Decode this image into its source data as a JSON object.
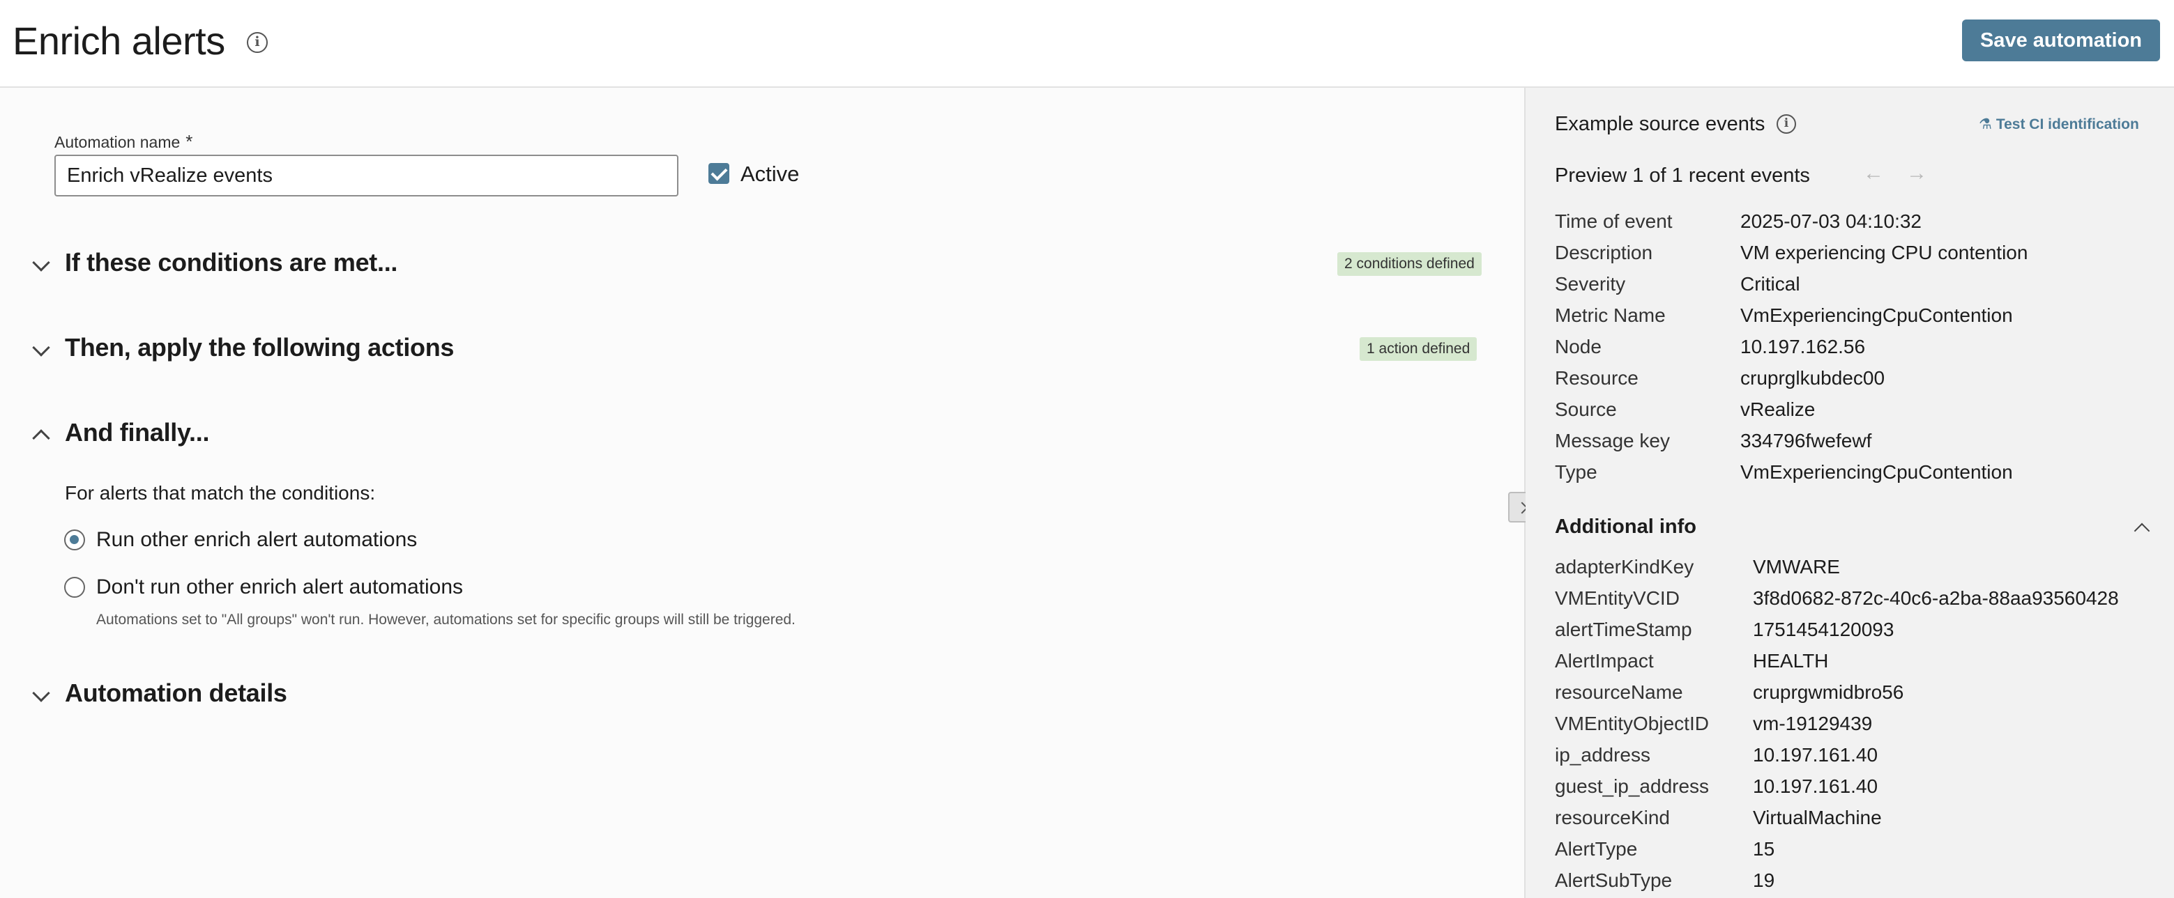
{
  "header": {
    "title": "Enrich alerts",
    "info_icon": "info-icon",
    "save_label": "Save automation"
  },
  "form": {
    "name_label": "Automation name",
    "required_mark": "*",
    "name_value": "Enrich vRealize events",
    "active_label": "Active",
    "active_checked": true
  },
  "sections": {
    "conditions": {
      "title": "If these conditions are met...",
      "badge": "2 conditions defined"
    },
    "actions": {
      "title": "Then, apply the following actions",
      "badge": "1 action defined"
    },
    "finally": {
      "title": "And finally...",
      "match_label": "For alerts that match the conditions:",
      "option_run": "Run other enrich alert automations",
      "option_dont_run": "Don't run other enrich alert automations",
      "help": "Automations set to \"All groups\" won't run. However, automations set for specific groups will still be triggered.",
      "selected": "run"
    },
    "details": {
      "title": "Automation details"
    }
  },
  "colors": {
    "accent": "#4d7b97",
    "badge_bg": "#d6e8cf"
  },
  "example": {
    "title": "Example source events",
    "test_link": "Test CI identification",
    "preview": "Preview 1 of 1 recent events",
    "fields": [
      {
        "key": "Time of event",
        "value": "2025-07-03 04:10:32"
      },
      {
        "key": "Description",
        "value": "VM experiencing CPU contention"
      },
      {
        "key": "Severity",
        "value": "Critical"
      },
      {
        "key": "Metric Name",
        "value": "VmExperiencingCpuContention"
      },
      {
        "key": "Node",
        "value": "10.197.162.56"
      },
      {
        "key": "Resource",
        "value": "cruprglkubdec00"
      },
      {
        "key": "Source",
        "value": "vRealize"
      },
      {
        "key": "Message key",
        "value": "334796fwefewf"
      },
      {
        "key": "Type",
        "value": "VmExperiencingCpuContention"
      }
    ],
    "additional_title": "Additional info",
    "additional": [
      {
        "key": "adapterKindKey",
        "value": "VMWARE"
      },
      {
        "key": "VMEntityVCID",
        "value": "3f8d0682-872c-40c6-a2ba-88aa93560428"
      },
      {
        "key": "alertTimeStamp",
        "value": "1751454120093"
      },
      {
        "key": "AlertImpact",
        "value": "HEALTH"
      },
      {
        "key": "resourceName",
        "value": "cruprgwmidbro56"
      },
      {
        "key": "VMEntityObjectID",
        "value": "vm-19129439"
      },
      {
        "key": "ip_address",
        "value": "10.197.161.40"
      },
      {
        "key": "guest_ip_address",
        "value": "10.197.161.40"
      },
      {
        "key": "resourceKind",
        "value": "VirtualMachine"
      },
      {
        "key": "AlertType",
        "value": "15"
      },
      {
        "key": "AlertSubType",
        "value": "19"
      }
    ]
  }
}
